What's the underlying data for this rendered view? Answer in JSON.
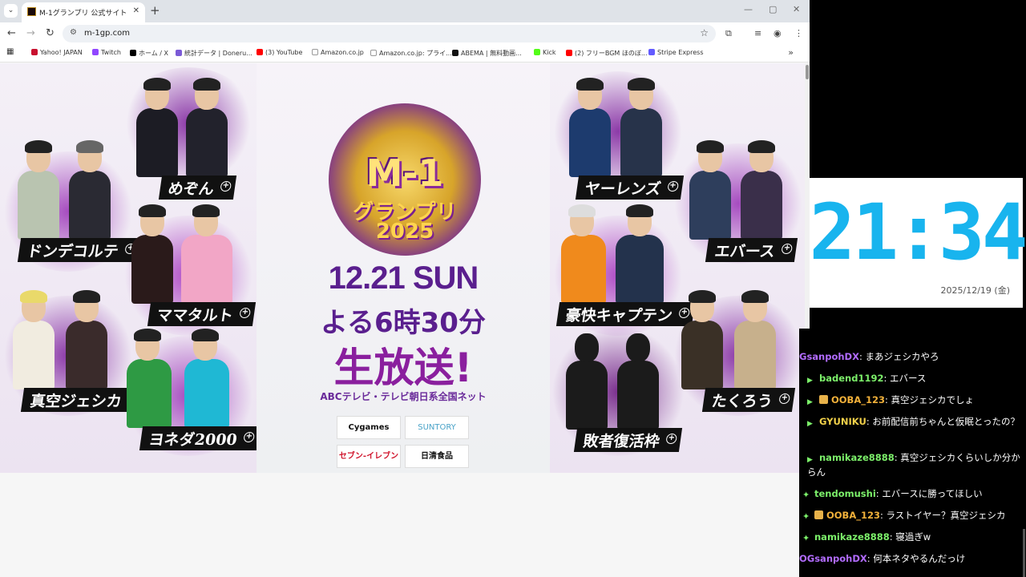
{
  "browser": {
    "tab": {
      "title": "M-1グランプリ 公式サイト"
    },
    "url": "m-1gp.com",
    "bookmarks": [
      "Yahoo! JAPAN",
      "Twitch",
      "ホーム / X",
      "統計データ | Doneru...",
      "(3) YouTube",
      "Amazon.co.jp",
      "Amazon.co.jp: プライ...",
      "ABEMA | 無料動画...",
      "Kick",
      "(2) フリーBGM ほのぼ...",
      "Stripe Express"
    ]
  },
  "page": {
    "left_combos": [
      "めぞん",
      "ドンデコルテ",
      "ママタルト",
      "真空ジェシカ",
      "ヨネダ2000"
    ],
    "right_combos": [
      "ヤーレンズ",
      "エバース",
      "豪快キャプテン",
      "たくろう",
      "敗者復活枠"
    ],
    "logo": {
      "line1": "M-1",
      "line2": "グランプリ",
      "line3": "2025"
    },
    "date": "12.21 SUN",
    "time": "よる6時30分",
    "live": "生放送!",
    "network": "ABCテレビ・テレビ朝日系全国ネット",
    "sponsors": [
      "Cygames",
      "SUNTORY",
      "セブン-イレブン",
      "日清食品"
    ]
  },
  "overlay": {
    "clock_time": "21:34",
    "clock_date": "2025/12/19 (金)",
    "chat": [
      {
        "user": "GsanpohDX",
        "text": ": まあジェシカやろ",
        "color": "#b26cff",
        "badge": ""
      },
      {
        "user": "badend1192",
        "text": ": エバース",
        "color": "#7cf06a",
        "badge": "arrow"
      },
      {
        "user": "OOBA_123",
        "text": ": 真空ジェシカでしょ",
        "color": "#f2b13a",
        "badge": "arrow-gift"
      },
      {
        "user": "GYUNIKU",
        "text": ": お前配信前ちゃんと仮眠とったの？",
        "color": "#f2d14a",
        "badge": "arrow"
      },
      {
        "user": "namikaze8888",
        "text": ": 真空ジェシカくらいしか分からん",
        "color": "#7cf06a",
        "badge": "arrow"
      },
      {
        "user": "tendomushi",
        "text": ": エバースに勝ってほしい",
        "color": "#7cf06a",
        "badge": "gem"
      },
      {
        "user": "OOBA_123",
        "text": ": ラストイヤー？真空ジェシカ",
        "color": "#f2b13a",
        "badge": "gem-gift"
      },
      {
        "user": "namikaze8888",
        "text": ": 寝過ぎw",
        "color": "#7cf06a",
        "badge": "gem"
      },
      {
        "user": "OGsanpohDX",
        "text": ": 何本ネタやるんだっけ",
        "color": "#b26cff",
        "badge": ""
      }
    ]
  }
}
